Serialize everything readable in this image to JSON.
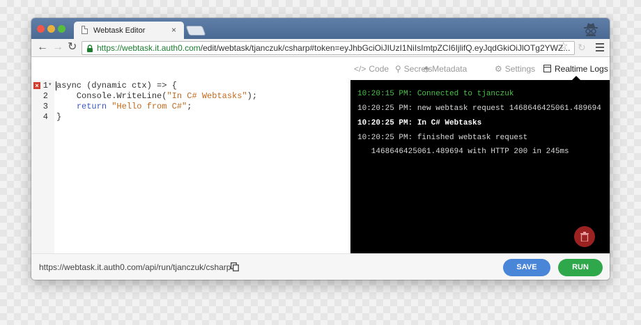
{
  "browser": {
    "tab_title": "Webtask Editor",
    "tab_close": "×",
    "url_scheme": "https://",
    "url_host": "webtask.it.auth0.com",
    "url_path": "/edit/webtask/tjanczuk/csharp#token=eyJhbGciOiJIUzI1NiIsImtpZCI6IjlifQ.eyJqdGkiOiJlOTg2YWZ...",
    "back_glyph": "←",
    "forward_glyph": "→",
    "reload_glyph": "↻",
    "star_glyph": "☆",
    "ext_glyph": "↻"
  },
  "app_tabs": {
    "code": {
      "icon": "</>",
      "label": "Code"
    },
    "secrets": {
      "icon": "⚲",
      "label": "Secrets"
    },
    "metadata": {
      "icon": "⬘",
      "label": "Metadata"
    },
    "settings": {
      "icon": "⚙",
      "label": "Settings"
    },
    "logs": {
      "label": "Realtime Logs"
    }
  },
  "editor": {
    "line_numbers": [
      "1",
      "2",
      "3",
      "4"
    ],
    "error_marker": "×",
    "fold_marker": "▾",
    "lines": [
      {
        "a": "async (dynamic ctx) => {",
        "b": "",
        "c": "",
        "d": ""
      },
      {
        "a": "    Console.WriteLine(",
        "b": "\"In C# Webtasks\"",
        "c": ");",
        "d": ""
      },
      {
        "a": "    ",
        "b": "return",
        "c": " ",
        "d": "\"Hello from C#\"",
        "e": ";"
      },
      {
        "a": "}"
      }
    ]
  },
  "logs": {
    "lines": [
      "10:20:15 PM: Connected to tjanczuk",
      "10:20:25 PM: new webtask request 1468646425061.489694",
      "10:20:25 PM: In C# Webtasks",
      "10:20:25 PM: finished webtask request",
      "   1468646425061.489694 with HTTP 200 in 245ms"
    ]
  },
  "footer": {
    "run_url": "https://webtask.it.auth0.com/api/run/tjanczuk/csharp",
    "save_label": "SAVE",
    "run_label": "RUN"
  },
  "colors": {
    "save": "#4a86d8",
    "run": "#2ea84a",
    "log_connected": "#4cc24a",
    "string": "#c26a1c",
    "keyword": "#3a57c4",
    "trash": "#9c2222"
  }
}
